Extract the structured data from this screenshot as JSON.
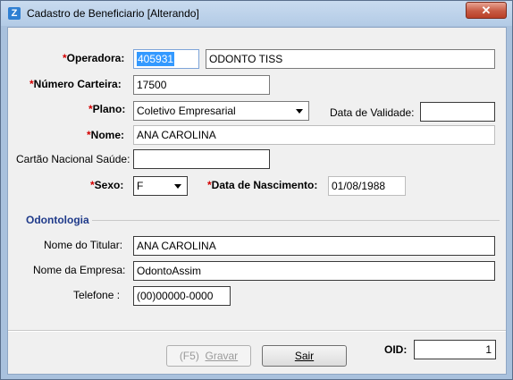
{
  "window": {
    "title": "Cadastro de Beneficiario [Alterando]",
    "close_glyph": "✕"
  },
  "form": {
    "operadora": {
      "label": "Operadora:",
      "code": "405931",
      "name": "ODONTO TISS"
    },
    "numero_carteira": {
      "label": "Número Carteira:",
      "value": "17500"
    },
    "plano": {
      "label": "Plano:",
      "value": "Coletivo Empresarial"
    },
    "data_validade": {
      "label": "Data de Validade:",
      "value": ""
    },
    "nome": {
      "label": "Nome:",
      "value": "ANA CAROLINA"
    },
    "cartao_sus": {
      "label": "Cartão Nacional Saúde:",
      "value": ""
    },
    "sexo": {
      "label": "Sexo:",
      "value": "F"
    },
    "data_nascimento": {
      "label": "Data de Nascimento:",
      "value": "01/08/1988"
    }
  },
  "odontologia": {
    "title": "Odontologia",
    "nome_titular": {
      "label": "Nome do Titular:",
      "value": "ANA CAROLINA"
    },
    "nome_empresa": {
      "label": "Nome da Empresa:",
      "value": "OdontoAssim"
    },
    "telefone": {
      "label": "Telefone :",
      "value": "(00)00000-0000"
    }
  },
  "footer": {
    "gravar_prefix": "(F5)",
    "gravar_label": "Gravar",
    "sair_label": "Sair",
    "oid_label": "OID:",
    "oid_value": "1"
  }
}
